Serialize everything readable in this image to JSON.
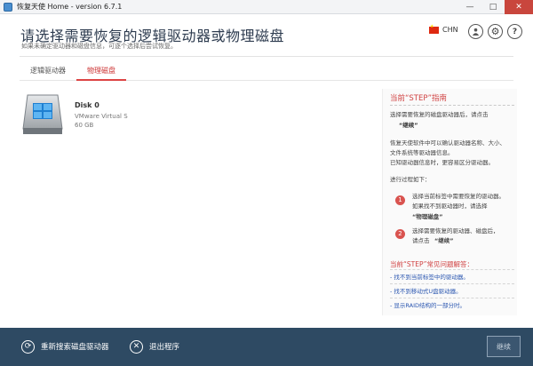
{
  "window": {
    "title": "恢复天使 Home - version 6.7.1",
    "controls": [
      "—",
      "□",
      "✕"
    ]
  },
  "header": {
    "title": "请选择需要恢复的逻辑驱动器或物理磁盘",
    "subtitle": "如果未确定驱动器和磁盘信息，可逐个选择后尝试恢复。",
    "language": "CHN",
    "icons": [
      "user-icon",
      "gear-icon",
      "help-icon"
    ]
  },
  "tabs": [
    {
      "label": "逻辑驱动器",
      "active": false
    },
    {
      "label": "物理磁盘",
      "active": true
    }
  ],
  "disk": {
    "name": "Disk 0",
    "model": "VMware Virtual S",
    "size": "60 GB"
  },
  "guide": {
    "title": "当前“STEP”指南",
    "intro_line1": "选择需要恢复的磁盘驱动器后，请点击",
    "intro_bold": "“继续”",
    "desc_line1": "恢复天使软件中可以确认驱动器名称、大小、",
    "desc_line2": "文件系统等驱动器信息。",
    "desc_line3": "已知驱动器信息时，更容易区分驱动器。",
    "process_label": "进行过程如下：",
    "step1_num": "1",
    "step1_line1": "选择当前标签中需要恢复的驱动器。",
    "step1_line2": "如果找不到驱动器时，请选择",
    "step1_bold": "“物理磁盘”",
    "step2_num": "2",
    "step2_line1": "选择需要恢复的驱动器、磁盘后，",
    "step2_line2": "请点击",
    "step2_bold": "“继续”",
    "faq_title": "当前“STEP”常见问题解答：",
    "faq": [
      "- 找不到当前标签中的驱动器。",
      "- 找不到移动式U盘驱动器。",
      "- 显示RAID结构的一部分时。"
    ]
  },
  "footer": {
    "rescan_label": "重新搜索磁盘驱动器",
    "exit_label": "退出程序",
    "continue_label": "继续"
  }
}
